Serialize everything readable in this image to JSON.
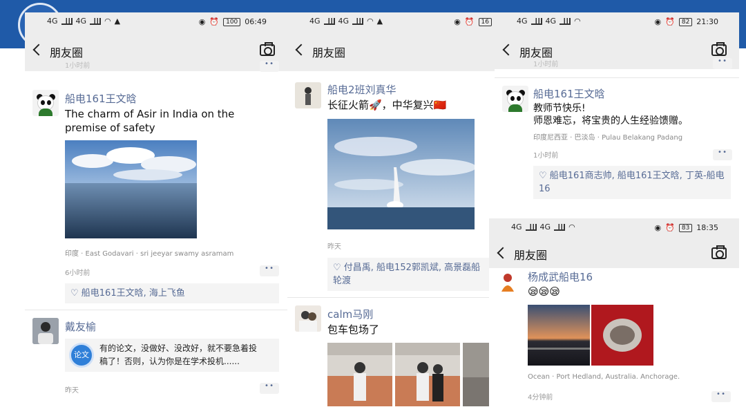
{
  "phones": [
    {
      "status": {
        "net1": "4G",
        "net2": "4G",
        "battery": "100",
        "time": "06:49"
      },
      "nav": {
        "title": "朋友圈"
      },
      "top_time": "1小时前",
      "posts": [
        {
          "user": "船电161王文晗",
          "text": "The charm of Asir in India on the premise of safety",
          "location": "印度 · East Godavari · sri jeeyar swamy asramam",
          "time": "6小时前",
          "likes": "♡ 船电161王文晗, 海上飞鱼"
        },
        {
          "user": "戴友榆",
          "link_icon_label": "论文",
          "link_text": "有的论文，没做好、没改好，就不要急着投稿了！否则，认为你是在学术投机......",
          "time": "昨天"
        }
      ]
    },
    {
      "status": {
        "net1": "4G",
        "net2": "4G",
        "battery": "16"
      },
      "nav": {
        "title": "朋友圈"
      },
      "posts": [
        {
          "user": "船电2班刘真华",
          "text": "长征火箭🚀，中华复兴🇨🇳",
          "time": "昨天",
          "likes": "♡ 付昌禹, 船电152郭凯斌, 高景磊船轮渡"
        },
        {
          "user": "calm马刚",
          "text": "包车包场了"
        }
      ]
    },
    {
      "status": {
        "net1": "4G",
        "net2": "4G",
        "battery": "82",
        "time": "21:30"
      },
      "nav": {
        "title": "朋友圈"
      },
      "top_time": "1小时前",
      "posts": [
        {
          "user": "船电161王文晗",
          "text_line1": "教师节快乐!",
          "text_line2": "师恩难忘，将宝贵的人生经验馈赠。",
          "location": "印度尼西亚 · 巴淡岛 · Pulau Belakang Padang",
          "time": "1小时前",
          "likes": "♡ 船电161商志帅, 船电161王文晗, 丁英-船电16"
        }
      ]
    },
    {
      "status": {
        "net1": "4G",
        "net2": "4G",
        "battery": "83",
        "time": "18:35"
      },
      "nav": {
        "title": "朋友圈"
      },
      "posts": [
        {
          "user": "杨成武船电16",
          "text": "😪😪😪",
          "location": "Ocean · Port Hedland, Australia. Anchorage.",
          "time": "4分钟前"
        }
      ]
    }
  ],
  "colors": {
    "username": "#576b95",
    "navbar": "#ededed",
    "banner": "#1f5aa8"
  }
}
